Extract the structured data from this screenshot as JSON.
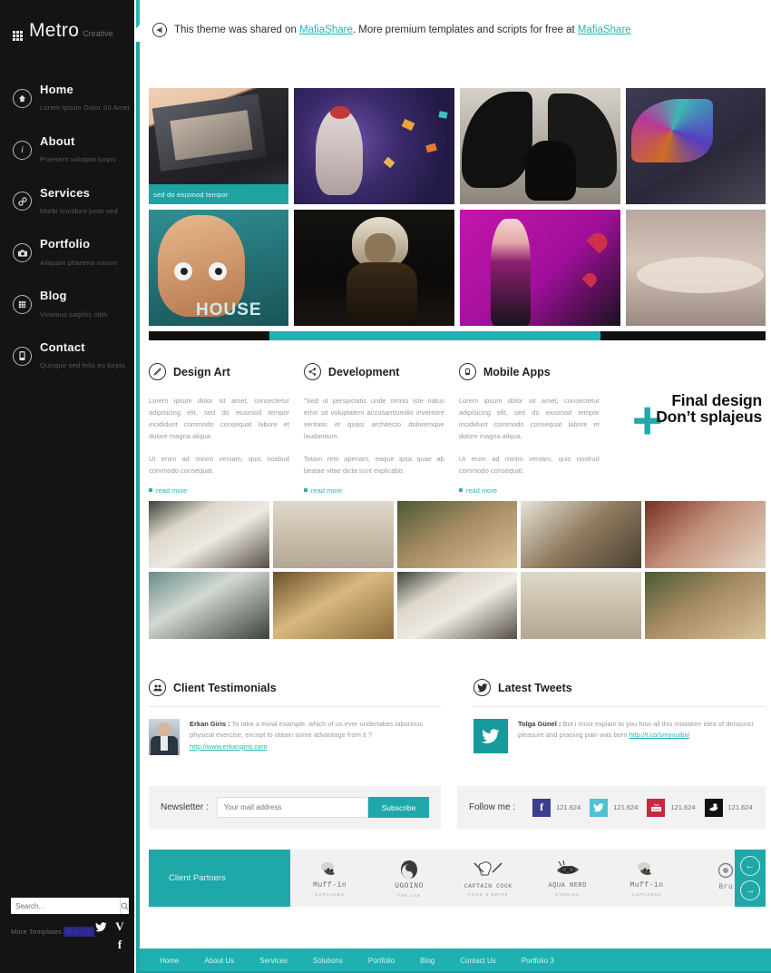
{
  "sidebar": {
    "brand": {
      "name": "Metro",
      "sub": "Creative",
      "icon": "grid-icon"
    },
    "items": [
      {
        "label": "Home",
        "desc": "Lorem Ipsum Dolor Sit Amet",
        "icon": "home-icon"
      },
      {
        "label": "About",
        "desc": "Praesent volutpat turpis",
        "icon": "info-icon"
      },
      {
        "label": "Services",
        "desc": "Morbi tincidunt justo sed",
        "icon": "link-icon"
      },
      {
        "label": "Portfolio",
        "desc": "Aliquam pharetra rutrum",
        "icon": "camera-icon"
      },
      {
        "label": "Blog",
        "desc": "Vivamus sagittis nibh",
        "icon": "grid-icon"
      },
      {
        "label": "Contact",
        "desc": "Quisque sed felis eu turpis",
        "icon": "phone-icon"
      }
    ],
    "search": {
      "placeholder": "Search...",
      "icon": "search-icon"
    },
    "more_templates": {
      "label": "More Templates",
      "highlight": "模板之家"
    },
    "socials": [
      {
        "name": "twitter-icon",
        "glyph": "✉"
      },
      {
        "name": "vimeo-icon",
        "glyph": "V"
      },
      {
        "name": "facebook-icon",
        "glyph": "f"
      }
    ]
  },
  "topbar": {
    "icon": "rewind-icon",
    "text_1": "This theme was shared on ",
    "link_1": "MafiaShare",
    "text_2": ". More premium templates and scripts for free at ",
    "link_2": "MafiaShare"
  },
  "slider": {
    "caption": "sed do eiusmod tempor",
    "tiles_row1": [
      "portfolio-print-mockup",
      "fantasy-butterfly-girl",
      "dark-angel-wings",
      "colorful-wing-art"
    ],
    "tiles_row2": [
      "house-md-caricature",
      "dark-hooded-portrait",
      "magenta-gothic-lady",
      "soft-landscape-art"
    ]
  },
  "services": [
    {
      "title": "Design Art",
      "icon": "pencil-icon",
      "p1": "Lorem ipsum dolor sit amet, consectetur adipisicing elit, sed do eiusmod tempor incididunt commodo consequat labore et dolore magna aliqua.",
      "p2": "Ut enim ad minim veniam, quis nosbud commodo consequat.",
      "read_more": "read more"
    },
    {
      "title": "Development",
      "icon": "share-icon",
      "p1": "\"Sed ut perspiciatis unde omnis iste natus error sit voluptatem accusantiumillo inventore veritatis et quasi architecto doloremque laudantium.",
      "p2": "Totam rem aperiam, eaque ipsa quae ab beatae vitae dicta sunt explicabo.",
      "read_more": "read more"
    },
    {
      "title": "Mobile Apps",
      "icon": "mobile-icon",
      "p1": "Lorem ipsum dolor sit amet, consectetur adipisicing elit, sed do eiusmod tempor incididunt commodo consequat labore et dolore magna aliqua.",
      "p2": "Ut enim ad minim veniam, quis nostrud commodo consequat.",
      "read_more": "read more"
    }
  ],
  "final_design": {
    "line1": "Final design",
    "line2": "Don’t splajeus",
    "plus": "+",
    "accent": "#21a8a8"
  },
  "gallery": {
    "row1": [
      "panda-grin",
      "fantasy-castle",
      "gnome-goggles",
      "dogs-collage",
      "gnome-crowd"
    ],
    "row2": [
      "wolf-cliff",
      "bird-nest",
      "panda-grin",
      "fantasy-castle",
      "gnome-goggles"
    ]
  },
  "testimonials": {
    "title": "Client Testimonials",
    "icon": "clients-icon",
    "author": "Erkan Giris :",
    "text": " To take a trivial example, which of us ever undertakes laborious physical exercise, except to obtain some advantage from it ?",
    "link": "http://www.erkangiris.com",
    "avatar": "client-avatar"
  },
  "tweets": {
    "title": "Latest Tweets",
    "icon": "twitter-icon",
    "author": "Tolga Günel :",
    "text": " But i must explain to you how all this mistaken idea of denounci pleasure and praising pain was born ",
    "link": "http://t.co/smynuibxl",
    "bird": "twitter-bird-icon"
  },
  "newsletter": {
    "label": "Newsletter :",
    "placeholder": "Your mail address",
    "value": "",
    "button": "Subscribe"
  },
  "follow": {
    "label": "Follow me :",
    "items": [
      {
        "name": "facebook-icon",
        "glyph": "f",
        "color": "#3b3f8f",
        "count": "121.624"
      },
      {
        "name": "twitter-icon",
        "glyph": "✉",
        "color": "#4ec3d4",
        "count": "121.624"
      },
      {
        "name": "youtube-icon",
        "glyph": "▶",
        "color": "#c32b3c",
        "count": "121.624"
      },
      {
        "name": "dribbble-icon",
        "glyph": "●",
        "color": "#111111",
        "count": "121.624"
      }
    ]
  },
  "partners": {
    "title": "Client Partners",
    "logos": [
      {
        "name": "Muff-in",
        "sub": "CUPCAKES"
      },
      {
        "name": "UGOINO",
        "sub": "THE LAB"
      },
      {
        "name": "CAPTAIN COOK",
        "sub": "FOOD & DRINK"
      },
      {
        "name": "AQUA NERD",
        "sub": "STUDIOS"
      },
      {
        "name": "Muff-in",
        "sub": "CUPCAKES"
      },
      {
        "name": "Bru",
        "sub": ""
      }
    ],
    "prev_icon": "arrow-left-icon",
    "next_icon": "arrow-right-icon"
  },
  "footer_nav": [
    "Home",
    "About Us",
    "Services",
    "Solutions",
    "Portfolio",
    "Blog",
    "Contact Us",
    "Portfolio 3"
  ],
  "colors": {
    "accent": "#1fa8a8",
    "accent_light": "#2bb3b3",
    "sidebar": "#141414",
    "footer": "#1fb1b1"
  }
}
